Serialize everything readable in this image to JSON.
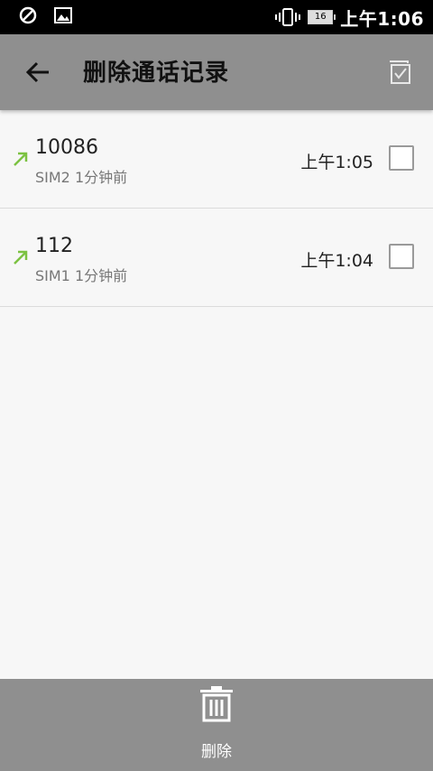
{
  "statusbar": {
    "battery_level": "16",
    "time": "上午1:06"
  },
  "appbar": {
    "title": "删除通话记录"
  },
  "calls": [
    {
      "number": "10086",
      "meta": "SIM2 1分钟前",
      "time": "上午1:05",
      "direction": "outgoing"
    },
    {
      "number": "112",
      "meta": "SIM1 1分钟前",
      "time": "上午1:04",
      "direction": "outgoing"
    }
  ],
  "bottom": {
    "delete_label": "删除"
  },
  "colors": {
    "accent_green": "#7cc242",
    "bar_gray": "#8f8f8f"
  }
}
